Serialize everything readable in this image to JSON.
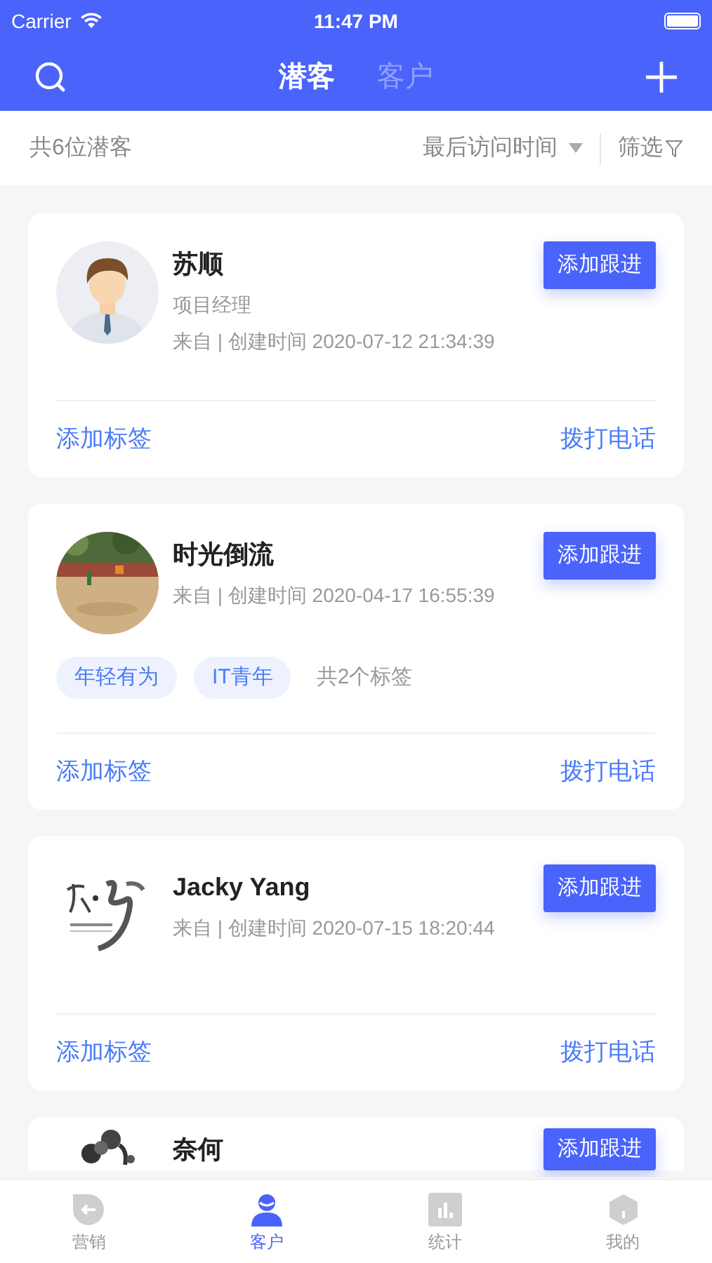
{
  "status_bar": {
    "carrier": "Carrier",
    "time": "11:47 PM"
  },
  "nav": {
    "tabs": [
      {
        "label": "潜客",
        "selected": true
      },
      {
        "label": "客户",
        "selected": false
      }
    ]
  },
  "filter_bar": {
    "count": "共6位潜客",
    "sort": "最后访问时间",
    "filter": "筛选"
  },
  "cards": [
    {
      "avatar": {
        "kind": "person"
      },
      "name": "苏顺",
      "title": "项目经理",
      "meta": "来自 | 创建时间 2020-07-12 21:34:39",
      "action": "添加跟进",
      "links": [
        "添加标签",
        "拨打电话"
      ]
    },
    {
      "name": "时光倒流",
      "meta": "来自 | 创建时间 2020-04-17 16:55:39",
      "tags": [
        "年轻有为",
        "IT青年"
      ],
      "tag_count": "共2个标签",
      "action": "添加跟进",
      "links": [
        "添加标签",
        "拨打电话"
      ]
    },
    {
      "avatar": {
        "kind": "brush"
      },
      "name": "Jacky Yang",
      "meta": "来自 | 创建时间 2020-07-15 18:20:44",
      "action": "添加跟进",
      "links": [
        "添加标签",
        "拨打电话"
      ]
    },
    {
      "avatar": {
        "kind": "ink"
      },
      "name": "奈何",
      "action": "添加跟进"
    }
  ],
  "tab_bar": [
    {
      "label": "营销",
      "kind": "back",
      "selected": false
    },
    {
      "label": "客户",
      "kind": "user",
      "selected": true
    },
    {
      "label": "统计",
      "kind": "chart",
      "selected": false
    },
    {
      "label": "我的",
      "kind": "home",
      "selected": false
    }
  ]
}
